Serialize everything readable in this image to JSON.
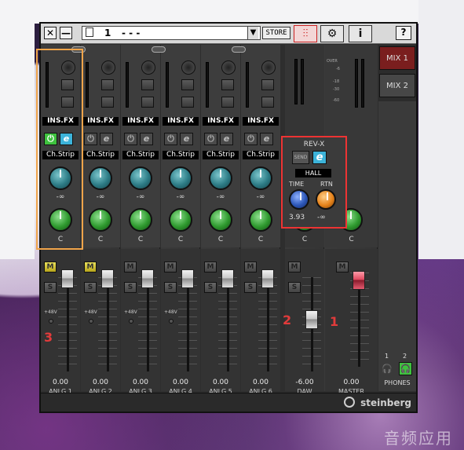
{
  "titlebar": {
    "close": "✕",
    "minimize": "—",
    "scene_number": "1",
    "scene_name": "- - -",
    "store_label": "STORE",
    "help_label": "?"
  },
  "channels": [
    {
      "id": "anlg1",
      "name": "ANLG 1",
      "ins": "INS.FX",
      "chstrip": "Ch.Strip",
      "power_on": true,
      "e_on": true,
      "pan": "C",
      "send": "-∞",
      "vol": "0.00",
      "mute_on": true,
      "phantom": "+48V"
    },
    {
      "id": "anlg2",
      "name": "ANLG 2",
      "ins": "INS.FX",
      "chstrip": "Ch.Strip",
      "power_on": false,
      "e_on": false,
      "pan": "C",
      "send": "-∞",
      "vol": "0.00",
      "mute_on": true,
      "phantom": "+48V"
    },
    {
      "id": "anlg3",
      "name": "ANLG 3",
      "ins": "INS.FX",
      "chstrip": "Ch.Strip",
      "power_on": false,
      "e_on": false,
      "pan": "C",
      "send": "-∞",
      "vol": "0.00",
      "mute_on": false,
      "phantom": "+48V"
    },
    {
      "id": "anlg4",
      "name": "ANLG 4",
      "ins": "INS.FX",
      "chstrip": "Ch.Strip",
      "power_on": false,
      "e_on": false,
      "pan": "C",
      "send": "-∞",
      "vol": "0.00",
      "mute_on": false,
      "phantom": "+48V"
    },
    {
      "id": "anlg5",
      "name": "ANLG 5",
      "ins": "INS.FX",
      "chstrip": "Ch.Strip",
      "power_on": false,
      "e_on": false,
      "pan": "C",
      "send": "-∞",
      "vol": "0.00",
      "mute_on": false,
      "phantom": ""
    },
    {
      "id": "anlg6",
      "name": "ANLG 6",
      "ins": "INS.FX",
      "chstrip": "Ch.Strip",
      "power_on": false,
      "e_on": false,
      "pan": "C",
      "send": "-∞",
      "vol": "0.00",
      "mute_on": false,
      "phantom": ""
    }
  ],
  "daw": {
    "name": "DAW",
    "vol": "-6.00",
    "pan": "C"
  },
  "master": {
    "name": "MASTER",
    "vol": "0.00",
    "pan": "C"
  },
  "rev": {
    "title": "REV-X",
    "send": "SEND",
    "e": "e",
    "type": "HALL",
    "time_label": "TIME",
    "rtn_label": "RTN",
    "time_val": "3.93",
    "rtn_val": "-∞"
  },
  "master_meter": {
    "scale": [
      "OVER",
      "-6",
      "-18",
      "-30",
      "-60"
    ]
  },
  "mix_tabs": [
    "MIX 1",
    "MIX 2"
  ],
  "phones": {
    "label": "PHONES",
    "n1": "1",
    "n2": "2"
  },
  "brand": "steinberg",
  "annotations": {
    "l1": "1",
    "l2": "2",
    "l3": "3"
  },
  "labels": {
    "m": "M",
    "s": "S",
    "e": "e",
    "pw": "⏻"
  },
  "watermark": "音频应用"
}
